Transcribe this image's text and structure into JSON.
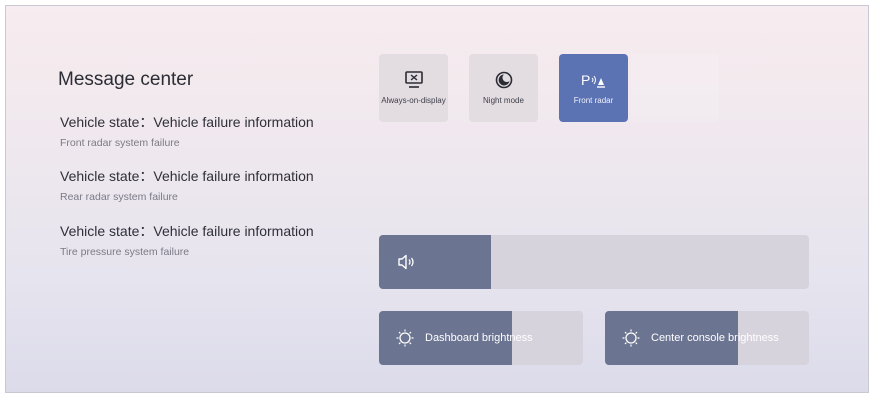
{
  "message_center": {
    "title": "Message center",
    "messages": [
      {
        "heading": "Vehicle state：Vehicle failure information",
        "detail": "Front radar system failure"
      },
      {
        "heading": "Vehicle state：Vehicle failure information",
        "detail": "Rear radar system failure"
      },
      {
        "heading": "Vehicle state：Vehicle failure information",
        "detail": "Tire pressure system failure"
      }
    ]
  },
  "quick_tiles": [
    {
      "label": "Always-on-display",
      "icon": "display-icon",
      "active": false
    },
    {
      "label": "Night mode",
      "icon": "moon-icon",
      "active": false
    },
    {
      "label": "Front radar",
      "icon": "parking-radar-icon",
      "active": true
    }
  ],
  "volume": {
    "icon": "speaker-icon",
    "level": 0.26
  },
  "brightness": [
    {
      "label": "Dashboard brightness",
      "icon": "sun-icon",
      "level": 0.65
    },
    {
      "label": "Center console brightness",
      "icon": "sun-icon",
      "level": 0.65
    }
  ],
  "colors": {
    "active_tile": "#5b72b3",
    "slider_fill": "#6b7491"
  }
}
